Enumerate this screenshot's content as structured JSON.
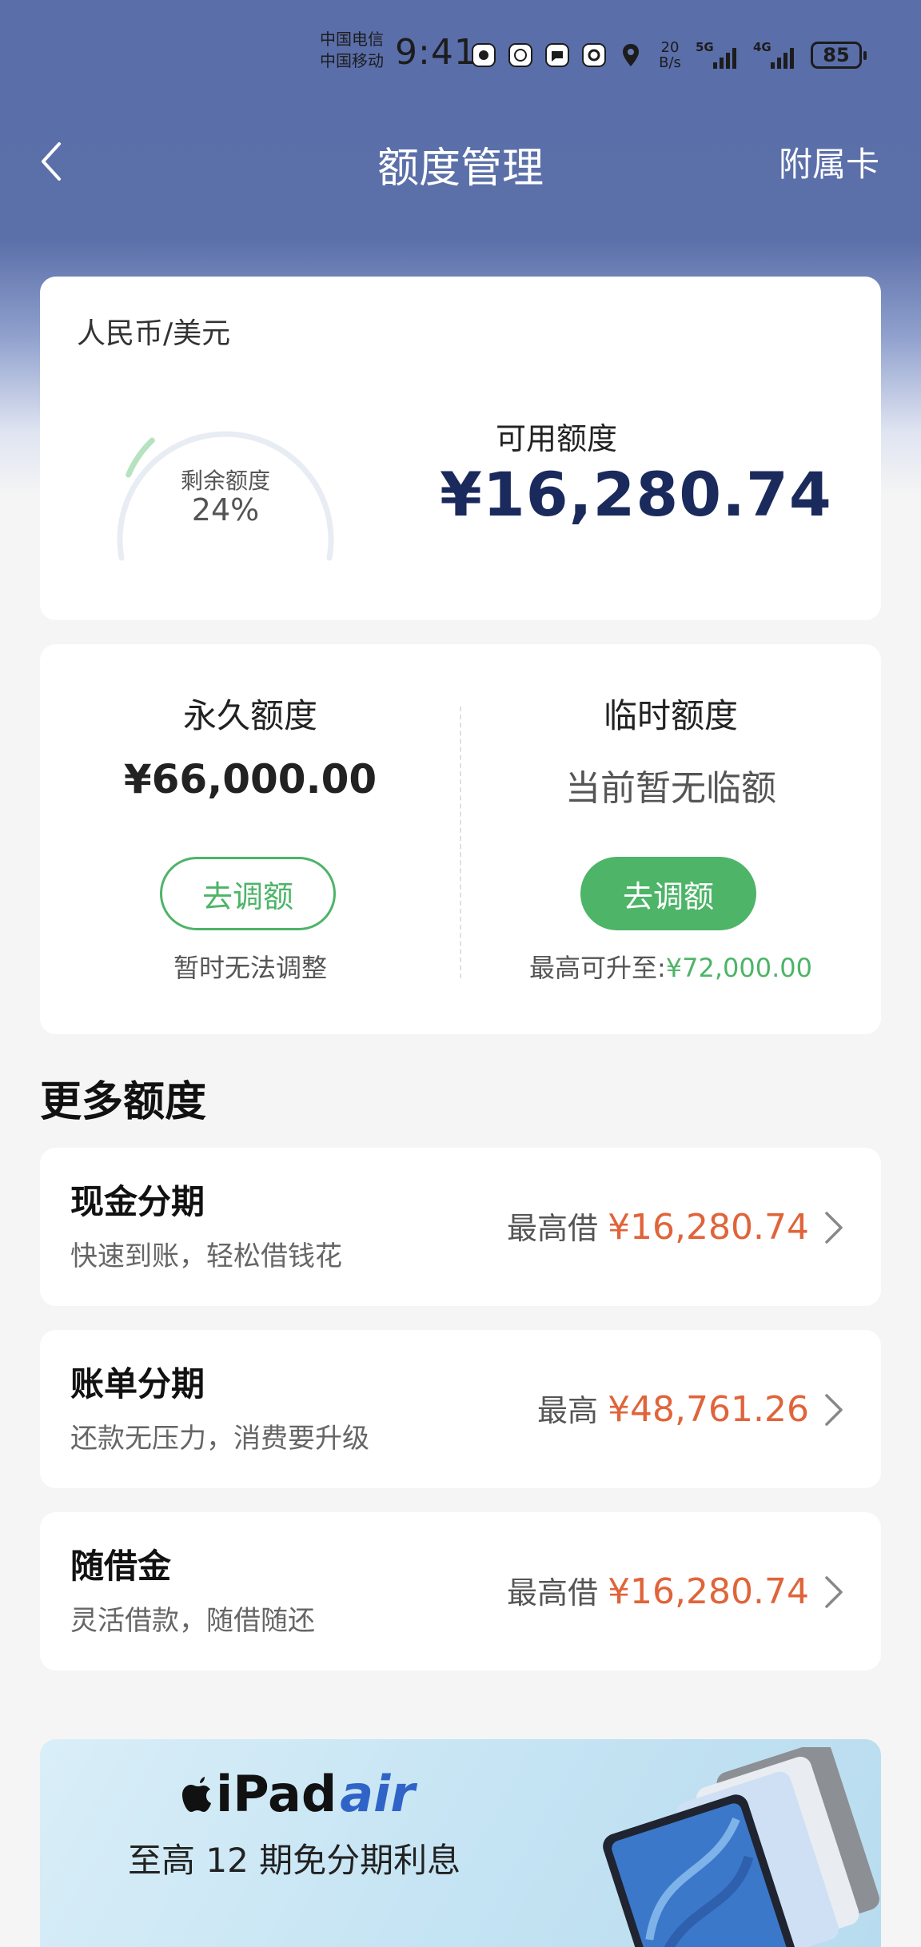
{
  "status_bar": {
    "carrier_1": "中国电信",
    "carrier_2": "中国移动",
    "time": "9:41",
    "net_speed_value": "20",
    "net_speed_unit": "B/s",
    "signal_1": "5G",
    "signal_2": "4G",
    "battery": "85"
  },
  "nav": {
    "title": "额度管理",
    "right_action": "附属卡"
  },
  "summary": {
    "currency": "人民币/美元",
    "gauge_label": "剩余额度",
    "gauge_percent": "24%",
    "gauge_fraction": 0.24,
    "available_label": "可用额度",
    "available_value": "¥16,280.74"
  },
  "limits": {
    "permanent": {
      "title": "永久额度",
      "value": "¥66,000.00",
      "button": "去调额",
      "note": "暂时无法调整"
    },
    "temporary": {
      "title": "临时额度",
      "value": "当前暂无临额",
      "button": "去调额",
      "note_prefix": "最高可升至:",
      "note_value": "¥72,000.00"
    }
  },
  "more": {
    "title": "更多额度",
    "items": [
      {
        "title": "现金分期",
        "subtitle": "快速到账，轻松借钱花",
        "prefix": "最高借",
        "amount": "¥16,280.74"
      },
      {
        "title": "账单分期",
        "subtitle": "还款无压力，消费要升级",
        "prefix": "最高",
        "amount": "¥48,761.26"
      },
      {
        "title": "随借金",
        "subtitle": "灵活借款，随借随还",
        "prefix": "最高借",
        "amount": "¥16,280.74"
      }
    ]
  },
  "banner": {
    "brand": "iPad",
    "brand_suffix": "air",
    "text": "至高 12 期免分期利息"
  },
  "colors": {
    "header": "#5a6ea9",
    "accent_green": "#4db468",
    "amount_orange": "#e0643a",
    "navy": "#1b2a5c"
  }
}
